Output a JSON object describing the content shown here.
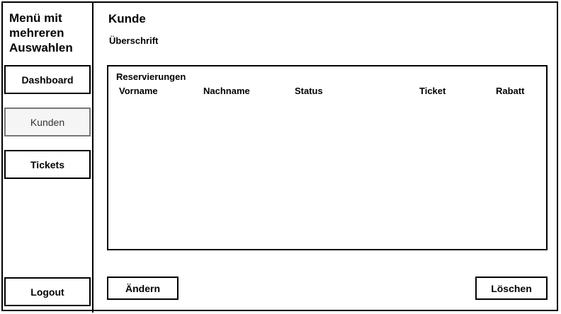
{
  "sidebar": {
    "title": "Menü mit mehreren Auswahlen",
    "items": [
      {
        "label": "Dashboard"
      },
      {
        "label": "Kunden"
      },
      {
        "label": "Tickets"
      }
    ],
    "logout_label": "Logout"
  },
  "main": {
    "title": "Kunde",
    "subtitle": "Überschrift",
    "panel": {
      "title": "Reservierungen",
      "columns": [
        "Vorname",
        "Nachname",
        "Status",
        "Ticket",
        "Rabatt"
      ]
    },
    "actions": {
      "edit_label": "Ändern",
      "delete_label": "Löschen"
    }
  }
}
